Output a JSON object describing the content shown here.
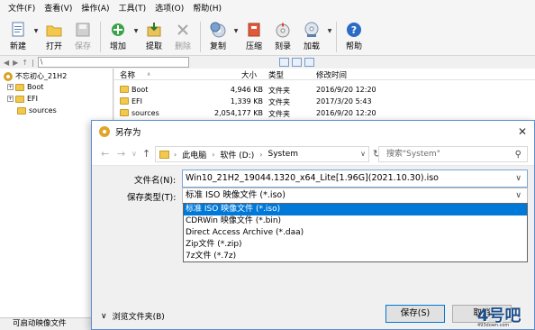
{
  "menu": [
    "文件(F)",
    "查看(V)",
    "操作(A)",
    "工具(T)",
    "选项(O)",
    "帮助(H)"
  ],
  "toolbar": [
    {
      "label": "新建",
      "icon": "new-file-icon"
    },
    {
      "label": "打开",
      "icon": "open-folder-icon"
    },
    {
      "label": "保存",
      "icon": "save-disk-icon",
      "disabled": true
    },
    {
      "label": "增加",
      "icon": "add-files-icon"
    },
    {
      "label": "提取",
      "icon": "extract-icon"
    },
    {
      "label": "删除",
      "icon": "delete-icon",
      "disabled": true
    },
    {
      "label": "复制",
      "icon": "copy-disc-icon"
    },
    {
      "label": "压缩",
      "icon": "compress-icon"
    },
    {
      "label": "刻录",
      "icon": "burn-icon"
    },
    {
      "label": "加载",
      "icon": "mount-icon"
    },
    {
      "label": "帮助",
      "icon": "help-icon"
    }
  ],
  "address": {
    "path": "\\"
  },
  "tree": {
    "root": "不忘初心_21H2",
    "items": [
      "Boot",
      "EFI",
      "sources"
    ]
  },
  "filelist": {
    "columns": {
      "name": "名称",
      "size": "大小",
      "type": "类型",
      "modified": "修改时间"
    },
    "rows": [
      {
        "name": "Boot",
        "size": "4,946 KB",
        "type": "文件夹",
        "modified": "2016/9/20 12:20"
      },
      {
        "name": "EFI",
        "size": "1,339 KB",
        "type": "文件夹",
        "modified": "2017/3/20 5:43"
      },
      {
        "name": "sources",
        "size": "2,054,177 KB",
        "type": "文件夹",
        "modified": "2016/9/20 12:20"
      }
    ]
  },
  "status": {
    "text": "可启动映像文件"
  },
  "dialog": {
    "title": "另存为",
    "breadcrumb": [
      "此电脑",
      "软件 (D:)",
      "System"
    ],
    "search_placeholder": "搜索\"System\"",
    "filename_label": "文件名(N):",
    "filename_value": "Win10_21H2_19044.1320_x64_Lite[1.96G](2021.10.30).iso",
    "filetype_label": "保存类型(T):",
    "filetype_value": "标准 ISO 映像文件 (*.iso)",
    "filetype_options": [
      "标准 ISO 映像文件 (*.iso)",
      "CDRWin 映像文件 (*.bin)",
      "Direct Access Archive (*.daa)",
      "Zip文件 (*.zip)",
      "7z文件 (*.7z)"
    ],
    "selected_option_index": 0,
    "browse_label": "浏览文件夹(B)",
    "save_button": "保存(S)",
    "cancel_button": "取消"
  },
  "watermark": {
    "text": "4号吧",
    "sub": "493down.com"
  },
  "colors": {
    "selection": "#0078d7",
    "dialog_border": "#5a8fcf",
    "folder": "#f2c94c"
  }
}
